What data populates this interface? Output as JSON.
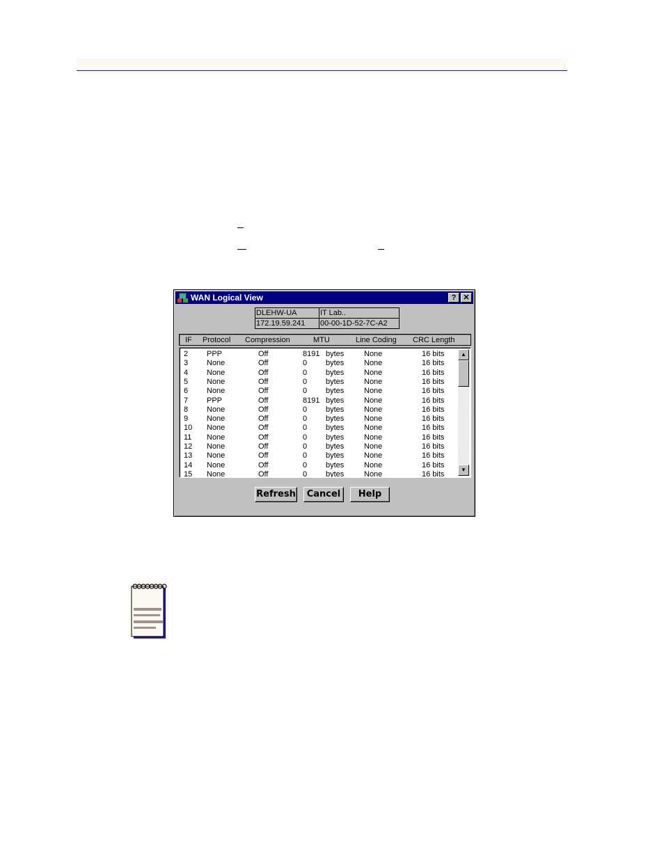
{
  "dialog": {
    "title": "WAN Logical View",
    "help_button": "?",
    "close_button": "✕",
    "device_info": {
      "name": "DLEHW-UA",
      "location": "IT Lab..",
      "ip_address": "172.19.59.241",
      "mac_address": "00-00-1D-52-7C-A2"
    },
    "columns": [
      "IF",
      "Protocol",
      "Compression",
      "MTU",
      "Line Coding",
      "CRC Length"
    ],
    "rows": [
      {
        "if": "2",
        "protocol": "PPP",
        "compression": "Off",
        "mtu": "8191",
        "mtu_unit": "bytes",
        "line_coding": "None",
        "crc": "16 bits"
      },
      {
        "if": "3",
        "protocol": "None",
        "compression": "Off",
        "mtu": "0",
        "mtu_unit": "bytes",
        "line_coding": "None",
        "crc": "16 bits"
      },
      {
        "if": "4",
        "protocol": "None",
        "compression": "Off",
        "mtu": "0",
        "mtu_unit": "bytes",
        "line_coding": "None",
        "crc": "16 bits"
      },
      {
        "if": "5",
        "protocol": "None",
        "compression": "Off",
        "mtu": "0",
        "mtu_unit": "bytes",
        "line_coding": "None",
        "crc": "16 bits"
      },
      {
        "if": "6",
        "protocol": "None",
        "compression": "Off",
        "mtu": "0",
        "mtu_unit": "bytes",
        "line_coding": "None",
        "crc": "16 bits"
      },
      {
        "if": "7",
        "protocol": "PPP",
        "compression": "Off",
        "mtu": "8191",
        "mtu_unit": "bytes",
        "line_coding": "None",
        "crc": "16 bits"
      },
      {
        "if": "8",
        "protocol": "None",
        "compression": "Off",
        "mtu": "0",
        "mtu_unit": "bytes",
        "line_coding": "None",
        "crc": "16 bits"
      },
      {
        "if": "9",
        "protocol": "None",
        "compression": "Off",
        "mtu": "0",
        "mtu_unit": "bytes",
        "line_coding": "None",
        "crc": "16 bits"
      },
      {
        "if": "10",
        "protocol": "None",
        "compression": "Off",
        "mtu": "0",
        "mtu_unit": "bytes",
        "line_coding": "None",
        "crc": "16 bits"
      },
      {
        "if": "11",
        "protocol": "None",
        "compression": "Off",
        "mtu": "0",
        "mtu_unit": "bytes",
        "line_coding": "None",
        "crc": "16 bits"
      },
      {
        "if": "12",
        "protocol": "None",
        "compression": "Off",
        "mtu": "0",
        "mtu_unit": "bytes",
        "line_coding": "None",
        "crc": "16 bits"
      },
      {
        "if": "13",
        "protocol": "None",
        "compression": "Off",
        "mtu": "0",
        "mtu_unit": "bytes",
        "line_coding": "None",
        "crc": "16 bits"
      },
      {
        "if": "14",
        "protocol": "None",
        "compression": "Off",
        "mtu": "0",
        "mtu_unit": "bytes",
        "line_coding": "None",
        "crc": "16 bits"
      },
      {
        "if": "15",
        "protocol": "None",
        "compression": "Off",
        "mtu": "0",
        "mtu_unit": "bytes",
        "line_coding": "None",
        "crc": "16 bits"
      }
    ],
    "buttons": {
      "refresh": "Refresh",
      "cancel": "Cancel",
      "help": "Help"
    },
    "scroll": {
      "up_arrow": "▲",
      "down_arrow": "▼"
    }
  },
  "colors": {
    "title_bar": "#000080",
    "dialog_bg": "#c0c0c0",
    "page_rule": "#1a1aa0"
  }
}
